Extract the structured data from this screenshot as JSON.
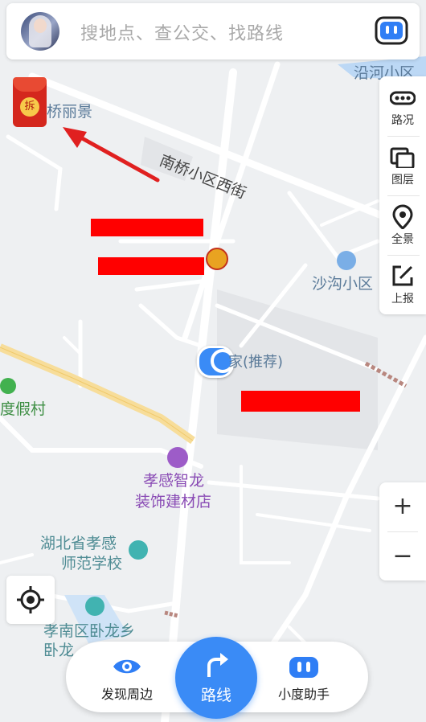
{
  "search": {
    "placeholder": "搜地点、查公交、找路线"
  },
  "side_tools": [
    {
      "label": "路况",
      "icon": "traffic-icon"
    },
    {
      "label": "图层",
      "icon": "layers-icon"
    },
    {
      "label": "全景",
      "icon": "panorama-icon"
    },
    {
      "label": "上报",
      "icon": "report-icon"
    }
  ],
  "zoom": {
    "in": "+",
    "out": "−"
  },
  "map_labels": {
    "yanhe": "沿河小区",
    "qiaolijing": "桥丽景",
    "nanqiao_street": "南桥小区西街",
    "shagou": "沙沟小区",
    "home": "家(推荐)",
    "dujia": "度假村",
    "zhilong_line1": "孝感智龙",
    "zhilong_line2": "装饰建材店",
    "normal_school_line1": "湖北省孝感",
    "normal_school_line2": "师范学校",
    "wolong_line1": "孝南区卧龙乡",
    "wolong_line2": "卧龙"
  },
  "hongbao": {
    "char": "拆"
  },
  "bottom_nav": {
    "discover": "发现周边",
    "route": "路线",
    "assistant": "小度助手"
  },
  "colors": {
    "accent": "#3a8bf6",
    "redaction": "#ff0000",
    "arrow": "#e02020"
  }
}
